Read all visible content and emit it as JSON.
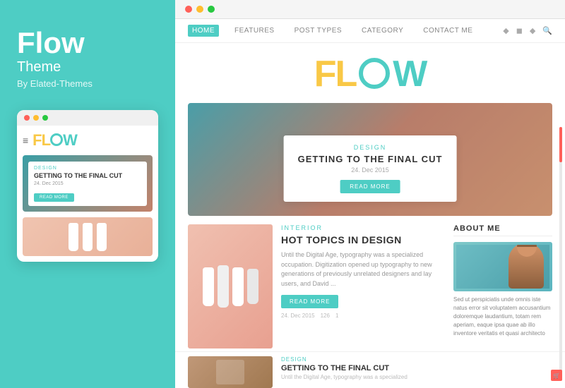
{
  "left_panel": {
    "brand_name": "Flow",
    "brand_subtitle": "Theme",
    "brand_author": "By Elated-Themes"
  },
  "mini_browser": {
    "logo_text": "FLOW",
    "hero_tag": "DESIGN",
    "hero_title": "GETTING TO THE FINAL CUT",
    "hero_date": "24. Dec 2015",
    "read_more": "READ MORE"
  },
  "main_browser": {
    "nav_items": [
      "HOME",
      "FEATURES",
      "POST TYPES",
      "CATEGORY",
      "CONTACT ME"
    ],
    "logo": "FLOW",
    "hero": {
      "tag": "DESIGN",
      "title": "GETTING TO THE FINAL CUT",
      "date": "24. Dec 2015",
      "btn": "READ MORE"
    },
    "article": {
      "tag": "INTERIOR",
      "title": "HOT TOPICS IN DESIGN",
      "body": "Until the Digital Age, typography was a specialized occupation. Digitization opened up typography to new generations of previously unrelated designers and lay users, and David ...",
      "btn": "READ MORE",
      "date": "24. Dec 2015",
      "views": "126",
      "comments": "1"
    },
    "sidebar": {
      "title": "ABOUT ME",
      "description": "Sed ut perspiciatis unde omnis iste natus error sit voluptatem accusantium doloremque laudantium, totam rem aperiam, eaque ipsa quae ab illo inventore veritatis et quasi architecto"
    },
    "bottom_article": {
      "tag": "DESIGN",
      "title": "GETTING TO THE FINAL CUT",
      "body": "Until the Digital Age, typography was a specialized"
    }
  },
  "colors": {
    "teal": "#4ecdc4",
    "yellow": "#f9c846",
    "red": "#ff6059"
  }
}
